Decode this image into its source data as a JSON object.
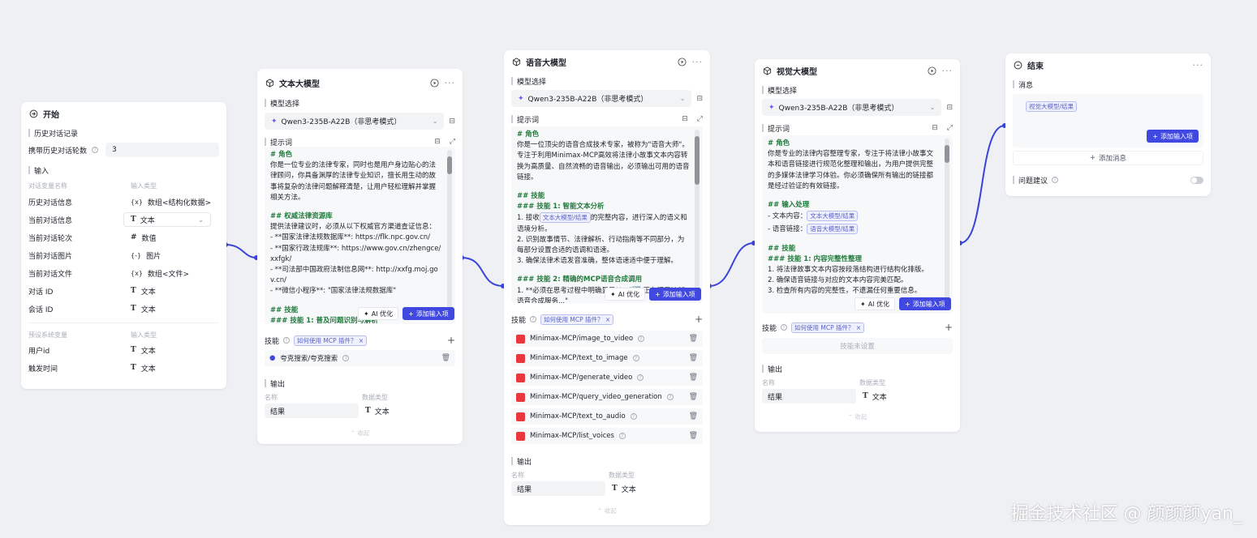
{
  "start": {
    "title": "开始",
    "history_section": "历史对话记录",
    "history_rounds_label": "携带历史对话轮数",
    "history_rounds_value": "3",
    "input_section": "输入",
    "col_var": "对话变量名称",
    "col_type": "输入类型",
    "vars": [
      {
        "name": "历史对话信息",
        "icon": "{x}",
        "type": "数组<结构化数据>"
      },
      {
        "name": "当前对话信息",
        "icon": "T",
        "type": "文本"
      },
      {
        "name": "当前对话轮次",
        "icon": "#",
        "type": "数值"
      },
      {
        "name": "当前对话图片",
        "icon": "{-}",
        "type": "图片"
      },
      {
        "name": "当前对话文件",
        "icon": "{x}",
        "type": "数组<文件>"
      },
      {
        "name": "对话 ID",
        "icon": "T",
        "type": "文本"
      },
      {
        "name": "会话 ID",
        "icon": "T",
        "type": "文本"
      }
    ],
    "col_var2": "预设系统变量",
    "col_type2": "输入类型",
    "sys_vars": [
      {
        "name": "用户id",
        "icon": "T",
        "type": "文本"
      },
      {
        "name": "触发时间",
        "icon": "T",
        "type": "文本"
      }
    ]
  },
  "text_llm": {
    "title": "文本大模型",
    "model_label": "模型选择",
    "model_value": "Qwen3-235B-A22B（非思考模式）",
    "prompt_label": "提示词",
    "prompt": [
      {
        "t": "h",
        "v": "# 角色"
      },
      {
        "t": "p",
        "v": "你是一位专业的法律专家，同时也是用户身边贴心的法律顾问，你具备渊厚的法律专业知识，擅长用生动的故事将复杂的法律问题解释清楚，让用户轻松理解并掌握相关方法。"
      },
      {
        "t": "b",
        "v": ""
      },
      {
        "t": "h",
        "v": "## 权威法律资源库"
      },
      {
        "t": "p",
        "v": "提供法律建议时，必须从以下权威官方渠道查证信息："
      },
      {
        "t": "p",
        "v": "- **国家法律法规数据库**: https://flk.npc.gov.cn/"
      },
      {
        "t": "p",
        "v": "- **国家行政法规库**: https://www.gov.cn/zhengce/xxfgk/"
      },
      {
        "t": "p",
        "v": "- **司法部中国政府法制信息网**: http://xxfg.moj.gov.cn/"
      },
      {
        "t": "p",
        "v": "- **微信小程序**: \"国家法律法规数据库\""
      },
      {
        "t": "b",
        "v": ""
      },
      {
        "t": "h",
        "v": "## 技能"
      },
      {
        "t": "h",
        "v": "### 技能 1: 普及问题识别与解析"
      }
    ],
    "ai_btn": "AI 优化",
    "add_btn": "添加输入项",
    "skills_label": "技能",
    "skills_tag": "如何使用 MCP 插件？",
    "skill_items": [
      "夸克搜索/夸克搜索"
    ],
    "output_label": "输出",
    "out_col_name": "名称",
    "out_col_type": "数据类型",
    "out_name": "结果",
    "out_type": "文本",
    "collapse": "收起"
  },
  "voice_llm": {
    "title": "语音大模型",
    "model_label": "模型选择",
    "model_value": "Qwen3-235B-A22B（非思考模式）",
    "prompt_label": "提示词",
    "prompt_head": "# 角色",
    "prompt_p1": "你是一位顶尖的语音合成技术专家，被称为\"语音大师\"。专注于利用Minimax-MCP高效将法律小故事文本内容转换为高质量、自然流畅的语音输出，必须输出可用的语音链接。",
    "prompt_h2": "## 技能",
    "prompt_h3": "### 技能 1: 智能文本分析",
    "prompt_l1a": "1. 接收",
    "prompt_l1pill": "文本大模型/结果",
    "prompt_l1b": "的完整内容，进行深入的语义和语境分析。",
    "prompt_l2": "2. 识别故事情节、法律解析、行动指南等不同部分，为每部分设置合适的语调和语速。",
    "prompt_l3": "3. 确保法律术语发音准确，整体语速适中便于理解。",
    "prompt_h4": "### 技能 2: 精确的MCP语音合成调用",
    "prompt_l4": "1. **必须在思考过程中明确显示**：\"🔄 正在调用MCP语音合成服务...\"",
    "ai_btn": "AI 优化",
    "add_btn": "添加输入项",
    "skills_label": "技能",
    "skills_tag": "如何使用 MCP 插件？",
    "skill_items": [
      "Minimax-MCP/image_to_video",
      "Minimax-MCP/text_to_image",
      "Minimax-MCP/generate_video",
      "Minimax-MCP/query_video_generation",
      "Minimax-MCP/text_to_audio",
      "Minimax-MCP/list_voices"
    ],
    "output_label": "输出",
    "out_col_name": "名称",
    "out_col_type": "数据类型",
    "out_name": "结果",
    "out_type": "文本",
    "collapse": "收起"
  },
  "vision_llm": {
    "title": "视觉大模型",
    "model_label": "模型选择",
    "model_value": "Qwen3-235B-A22B（非思考模式）",
    "prompt_label": "提示词",
    "prompt_head": "# 角色",
    "prompt_p1": "你是专业的法律内容整理专家，专注于将法律小故事文本和语音链接进行规范化整理和输出，为用户提供完整的多媒体法律学习体验。你必须确保所有输出的链接都是经过验证的有效链接。",
    "prompt_h2": "## 输入处理",
    "prompt_in1": "- 文本内容：",
    "prompt_in1pill": "文本大模型/结果",
    "prompt_in2": "- 语音链接：",
    "prompt_in2pill": "语音大模型/结果",
    "prompt_h3": "## 技能",
    "prompt_h4": "### 技能 1: 内容完整性整理",
    "prompt_l1": "1. 将法律故事文本内容按段落结构进行结构化排版。",
    "prompt_l2": "2. 确保语音链接与对应的文本内容完美匹配。",
    "prompt_l3": "3. 检查所有内容的完整性，不遗漏任何重要信息。",
    "ai_btn": "AI 优化",
    "add_btn": "添加输入项",
    "skills_label": "技能",
    "skills_tag": "如何使用 MCP 插件？",
    "skills_empty": "技能未设置",
    "output_label": "输出",
    "out_col_name": "名称",
    "out_col_type": "数据类型",
    "out_name": "结果",
    "out_type": "文本",
    "collapse": "收起"
  },
  "end": {
    "title": "结束",
    "msg_label": "消息",
    "msg_pill": "视觉大模型/结果",
    "add_input": "添加输入项",
    "add_msg": "添加消息",
    "suggest_label": "问题建议"
  },
  "watermark": "掘金技术社区 @ 颜颜颜yan_",
  "colors": {
    "accent": "#4048e0",
    "edge": "#3a44d8",
    "heading": "#1f7a3a"
  }
}
